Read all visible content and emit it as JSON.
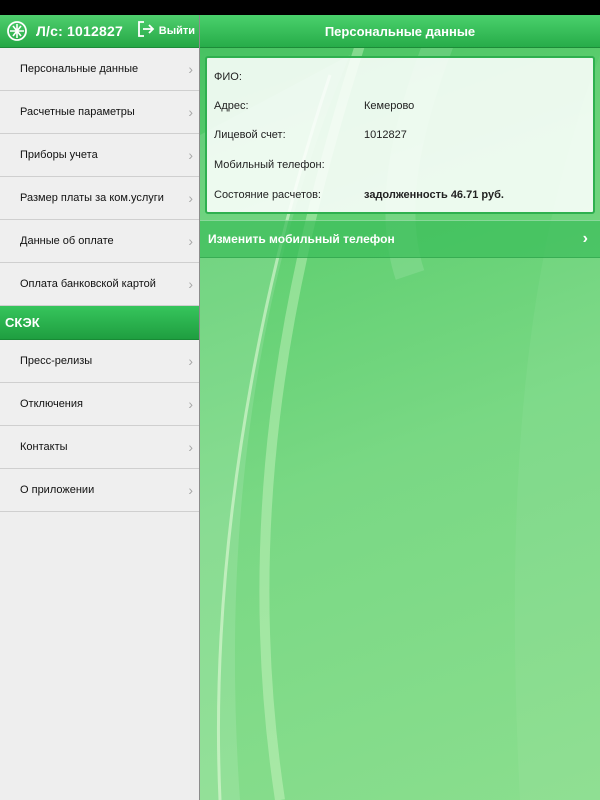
{
  "sidebar": {
    "account_label": "Л/с: 1012827",
    "logout_label": "Выйти",
    "items": [
      {
        "label": "Персональные данные"
      },
      {
        "label": "Расчетные параметры"
      },
      {
        "label": "Приборы учета"
      },
      {
        "label": "Размер платы за ком.услуги"
      },
      {
        "label": "Данные об оплате"
      },
      {
        "label": "Оплата банковской картой"
      }
    ],
    "section_title": "СКЭК",
    "section_items": [
      {
        "label": "Пресс-релизы"
      },
      {
        "label": "Отключения"
      },
      {
        "label": "Контакты"
      },
      {
        "label": "О приложении"
      }
    ],
    "chevron": "›"
  },
  "main": {
    "title": "Персональные данные",
    "info": {
      "fio_label": "ФИО:",
      "fio_value": "",
      "address_label": "Адрес:",
      "address_value": "Кемерово",
      "account_label": "Лицевой счет:",
      "account_value": "1012827",
      "phone_label": "Мобильный телефон:",
      "phone_value": "",
      "status_label": "Состояние расчетов:",
      "status_value": "задолженность 46.71 руб."
    },
    "change_phone_label": "Изменить мобильный телефон",
    "change_phone_chevron": "›"
  },
  "colors": {
    "accent_green": "#27ac49",
    "sidebar_bg": "#eeeeee"
  },
  "icons": {
    "logo": "company-logo-icon",
    "logout": "logout-icon",
    "chevron": "chevron-right-icon"
  }
}
